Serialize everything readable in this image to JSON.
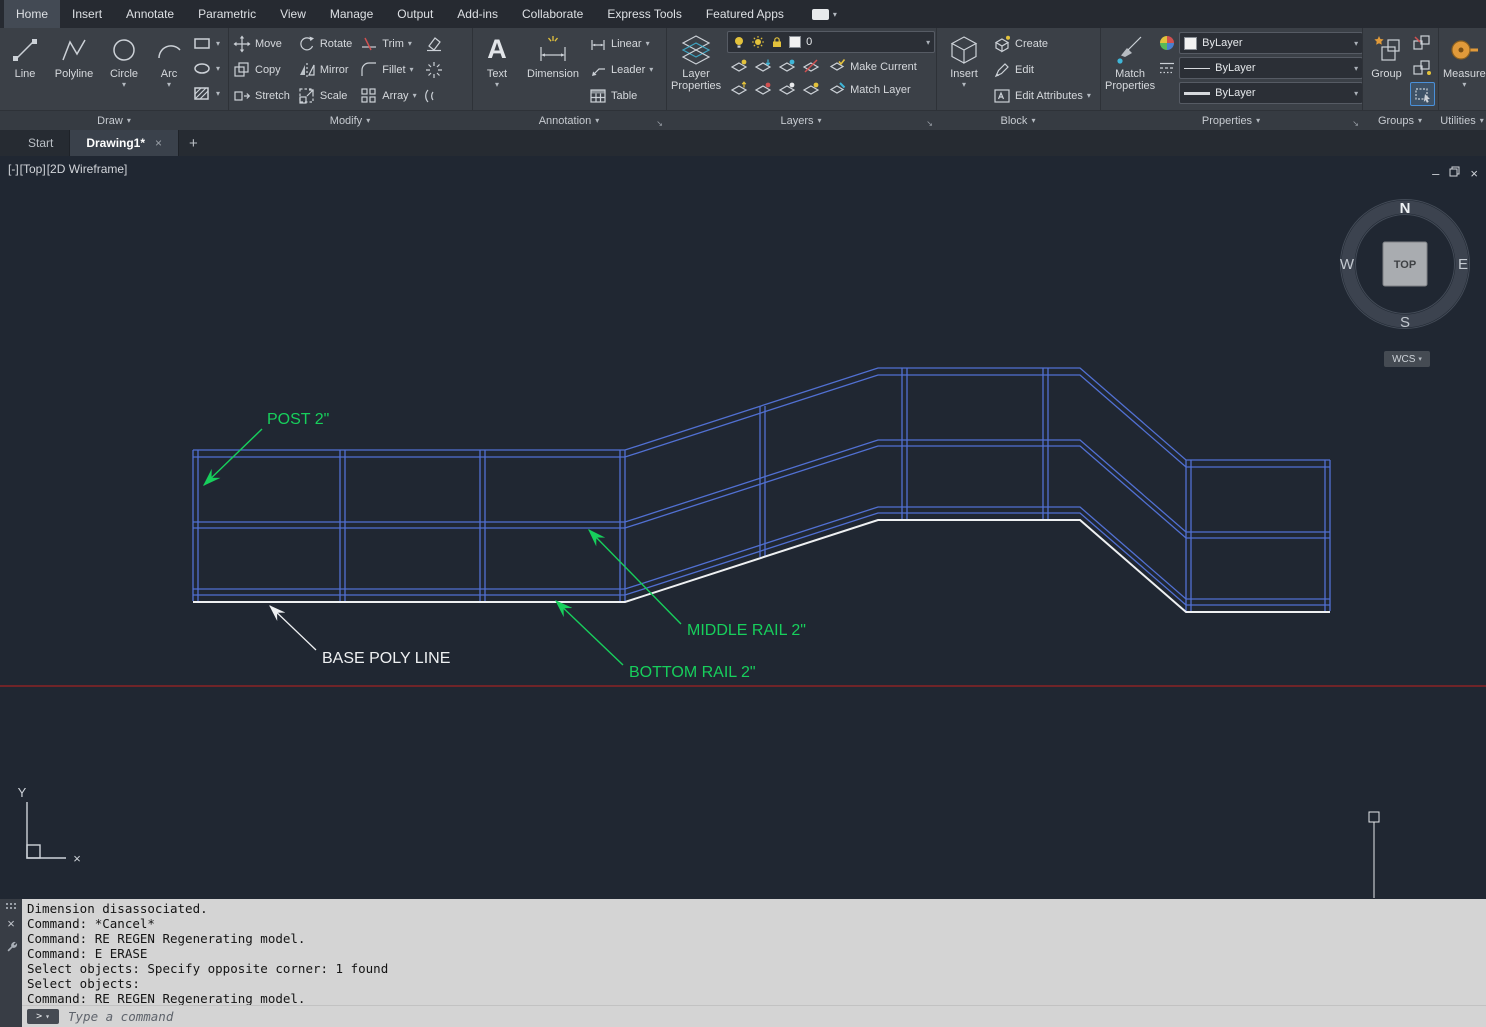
{
  "icons": {
    "caret_down": "▾",
    "close": "×",
    "plus": "+",
    "minimize": "–",
    "prompt_arrow": ">",
    "launcher": "↘",
    "text_glyph": "A"
  },
  "menubar": {
    "active_tab": "Home",
    "tabs": [
      "Home",
      "Insert",
      "Annotate",
      "Parametric",
      "View",
      "Manage",
      "Output",
      "Add-ins",
      "Collaborate",
      "Express Tools",
      "Featured Apps"
    ]
  },
  "ribbon": {
    "draw": {
      "panel_label": "Draw",
      "line": "Line",
      "polyline": "Polyline",
      "circle": "Circle",
      "arc": "Arc"
    },
    "modify": {
      "panel_label": "Modify",
      "move": "Move",
      "copy": "Copy",
      "stretch": "Stretch",
      "rotate": "Rotate",
      "mirror": "Mirror",
      "scale": "Scale",
      "trim": "Trim",
      "fillet": "Fillet",
      "array": "Array"
    },
    "annotation": {
      "panel_label": "Annotation",
      "text": "Text",
      "dimension": "Dimension",
      "linear": "Linear",
      "leader": "Leader",
      "table": "Table"
    },
    "layers": {
      "panel_label": "Layers",
      "layer_properties_line1": "Layer",
      "layer_properties_line2": "Properties",
      "current_layer": "0",
      "make_current": "Make Current",
      "match_layer": "Match Layer"
    },
    "block": {
      "panel_label": "Block",
      "insert": "Insert",
      "create": "Create",
      "edit": "Edit",
      "edit_attributes": "Edit Attributes"
    },
    "properties": {
      "panel_label": "Properties",
      "match_line1": "Match",
      "match_line2": "Properties",
      "color": "ByLayer",
      "linetype": "ByLayer",
      "lineweight": "ByLayer"
    },
    "groups": {
      "panel_label": "Groups",
      "group": "Group"
    },
    "utilities": {
      "panel_label": "Utilities",
      "measure": "Measure"
    }
  },
  "file_tabs": {
    "start": "Start",
    "drawing": "Drawing1*"
  },
  "viewport": {
    "control_collapse": "[-]",
    "control_view": "[Top]",
    "control_visual": "[2D Wireframe]",
    "ucs_y": "Y",
    "ucs_x": "×",
    "wcs": "WCS",
    "compass": {
      "n": "N",
      "w": "W",
      "e": "E",
      "s": "S",
      "cube": "TOP"
    }
  },
  "drawing_labels": {
    "post": "POST 2\"",
    "middle_rail": "MIDDLE RAIL 2\"",
    "bottom_rail": "BOTTOM RAIL 2\"",
    "base_poly": "BASE POLY LINE"
  },
  "colors": {
    "wireframe": "#5170d2",
    "annotation": "#17cf5c",
    "base_line": "#eef0f2",
    "ground": "#8a2424"
  },
  "command_line": {
    "history": [
      "Dimension disassociated.",
      "Command: *Cancel*",
      "Command: RE REGEN Regenerating model.",
      "Command: E ERASE",
      "Select objects: Specify opposite corner: 1 found",
      "Select objects:",
      "Command: RE REGEN Regenerating model."
    ],
    "prompt": "Type a command"
  }
}
